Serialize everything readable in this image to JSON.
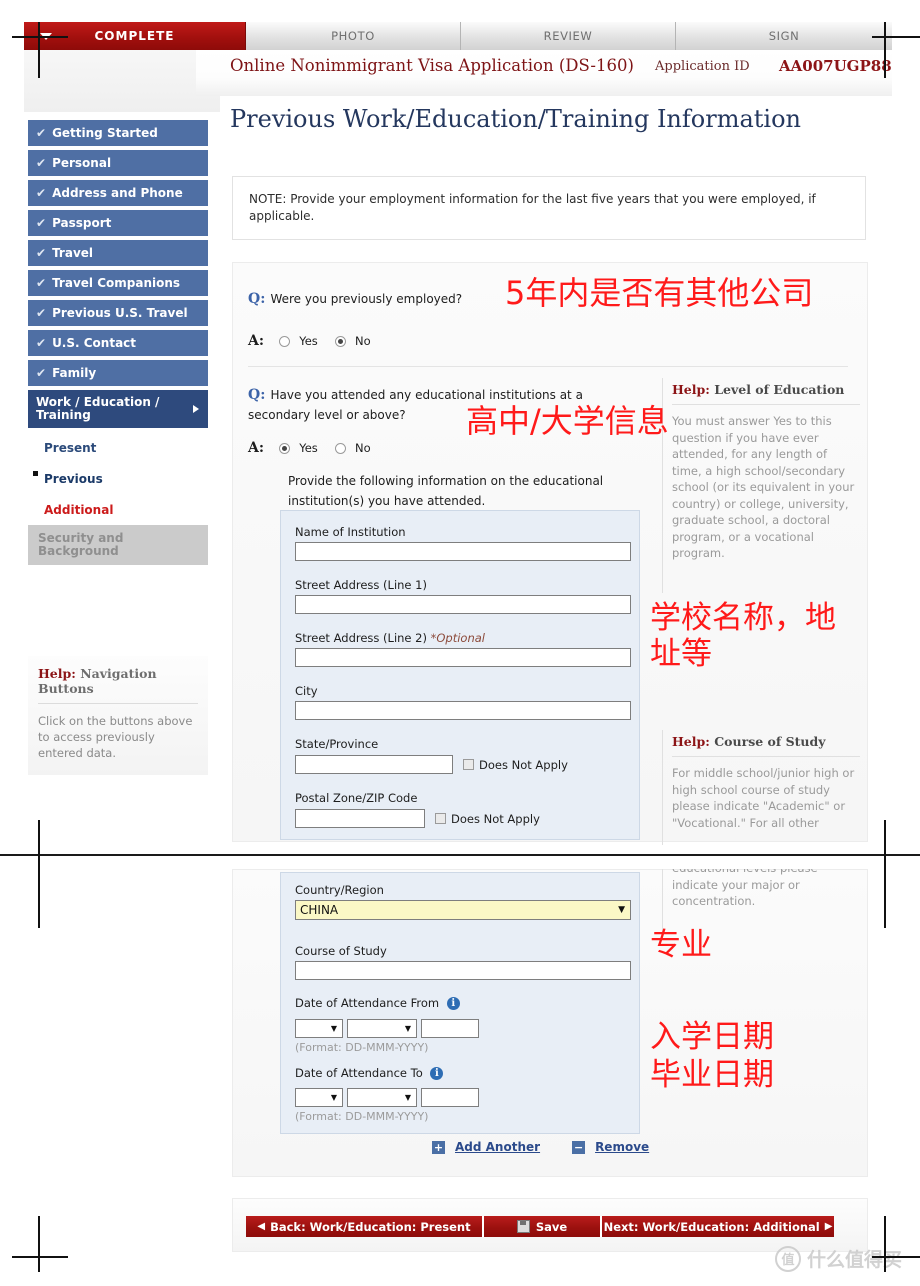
{
  "tabs": [
    {
      "label": "COMPLETE",
      "state": "active"
    },
    {
      "label": "PHOTO",
      "state": "inactive"
    },
    {
      "label": "REVIEW",
      "state": "inactive"
    },
    {
      "label": "SIGN",
      "state": "inactive"
    }
  ],
  "header": {
    "title": "Online Nonimmigrant Visa Application (DS-160)",
    "app_id_label": "Application ID",
    "app_id_value": "AA007UGP88"
  },
  "sidebar": {
    "items": [
      {
        "label": "Getting Started",
        "check": "✔"
      },
      {
        "label": "Personal",
        "check": "✔"
      },
      {
        "label": "Address and Phone",
        "check": "✔"
      },
      {
        "label": "Passport",
        "check": "✔"
      },
      {
        "label": "Travel",
        "check": "✔"
      },
      {
        "label": "Travel Companions",
        "check": "✔"
      },
      {
        "label": "Previous U.S. Travel",
        "check": "✔"
      },
      {
        "label": "U.S. Contact",
        "check": "✔"
      },
      {
        "label": "Family",
        "check": "✔"
      }
    ],
    "active_item": "Work / Education / Training",
    "sub_items": [
      {
        "label": "Present"
      },
      {
        "label": "Previous"
      },
      {
        "label": "Additional"
      }
    ],
    "disabled_item": "Security and Background",
    "help": {
      "title_prefix": "Help:",
      "title": "Navigation Buttons",
      "body": "Click on the buttons above to access previously entered data."
    }
  },
  "main": {
    "page_title": "Previous Work/Education/Training Information",
    "note": "NOTE: Provide your employment information for the last five years that you were employed, if applicable.",
    "q1": {
      "q_label": "Q:",
      "question": "Were you previously employed?",
      "a_label": "A:",
      "yes": "Yes",
      "no": "No",
      "selected": "No"
    },
    "q2": {
      "q_label": "Q:",
      "question": "Have you attended any educational institutions at a secondary level or above?",
      "a_label": "A:",
      "yes": "Yes",
      "no": "No",
      "selected": "Yes",
      "instruction": "Provide the following information on the educational institution(s) you have attended."
    },
    "form": {
      "name_of_institution": {
        "label": "Name of Institution",
        "value": ""
      },
      "street1": {
        "label": "Street Address (Line 1)",
        "value": ""
      },
      "street2": {
        "label": "Street Address (Line 2)",
        "optional": "*Optional",
        "value": ""
      },
      "city": {
        "label": "City",
        "value": ""
      },
      "state": {
        "label": "State/Province",
        "value": "",
        "dna": "Does Not Apply"
      },
      "postal": {
        "label": "Postal Zone/ZIP Code",
        "value": "",
        "dna": "Does Not Apply"
      },
      "country": {
        "label": "Country/Region",
        "value": "CHINA"
      },
      "course": {
        "label": "Course of Study",
        "value": ""
      },
      "date_from": {
        "label": "Date of Attendance From",
        "day": "",
        "month": "",
        "year": "",
        "format": "(Format: DD-MMM-YYYY)"
      },
      "date_to": {
        "label": "Date of Attendance To",
        "day": "",
        "month": "",
        "year": "",
        "format": "(Format: DD-MMM-YYYY)"
      }
    },
    "add_another": "Add Another",
    "remove": "Remove",
    "help_education": {
      "title_prefix": "Help:",
      "title": "Level of Education",
      "body": "You must answer Yes to this question if you have ever attended, for any length of time, a high school/secondary school (or its equivalent in your country) or college, university, graduate school, a doctoral program, or a vocational program."
    },
    "help_course": {
      "title_prefix": "Help:",
      "title": "Course of Study",
      "body_top": "For middle school/junior high or high school course of study please indicate \"Academic\" or \"Vocational.\" For all other",
      "body_bottom": "educational levels please indicate your major or concentration."
    },
    "buttons": {
      "back": "Back: Work/Education: Present",
      "save": "Save",
      "next": "Next: Work/Education: Additional"
    }
  },
  "annotations": [
    {
      "id": "ann-employment",
      "text": "5年内是否有其他公司"
    },
    {
      "id": "ann-education",
      "text": "高中/大学信息"
    },
    {
      "id": "ann-school-name",
      "text": "学校名称，地\n址等"
    },
    {
      "id": "ann-major",
      "text": "专业"
    },
    {
      "id": "ann-dates",
      "text": "入学日期\n毕业日期"
    }
  ],
  "watermark": {
    "mark": "值",
    "text": "什么值得买"
  },
  "colors": {
    "brand_red": "#a00f0d",
    "nav_blue": "#4f6fa4",
    "nav_blue_active": "#2e4a7d",
    "annotation_red": "#ff1a1a",
    "select_yellow": "#fbf8c6"
  }
}
